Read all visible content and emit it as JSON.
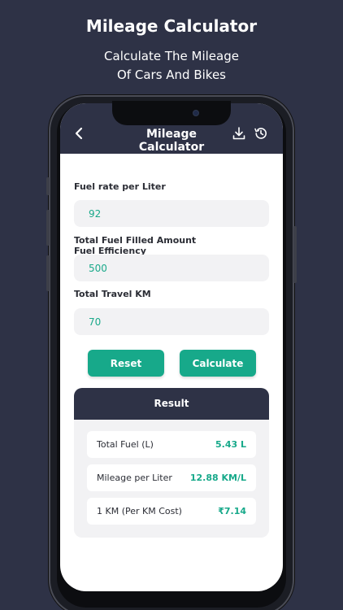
{
  "promo": {
    "title": "Mileage Calculator",
    "subtitle_line1": "Calculate The Mileage",
    "subtitle_line2": "Of Cars And Bikes"
  },
  "header": {
    "title": "Mileage Calculator",
    "back_icon": "chevron-left-icon",
    "download_icon": "download-icon",
    "history_icon": "history-icon"
  },
  "form": {
    "fuel_rate": {
      "label": "Fuel rate per Liter",
      "value": "92"
    },
    "fuel_amount": {
      "label_line1": "Total Fuel Filled Amount",
      "label_line2": "Fuel Efficiency",
      "value": "500"
    },
    "travel_km": {
      "label": "Total Travel KM",
      "value": "70"
    }
  },
  "buttons": {
    "reset": "Reset",
    "calculate": "Calculate"
  },
  "result": {
    "title": "Result",
    "rows": [
      {
        "label": "Total Fuel (L)",
        "value": "5.43 L"
      },
      {
        "label": "Mileage per Liter",
        "value": "12.88 KM/L"
      },
      {
        "label": "1 KM (Per KM Cost)",
        "value": "₹7.14"
      }
    ]
  },
  "colors": {
    "background": "#2e3246",
    "accent": "#17a98a",
    "input_bg": "#f2f2f4"
  }
}
